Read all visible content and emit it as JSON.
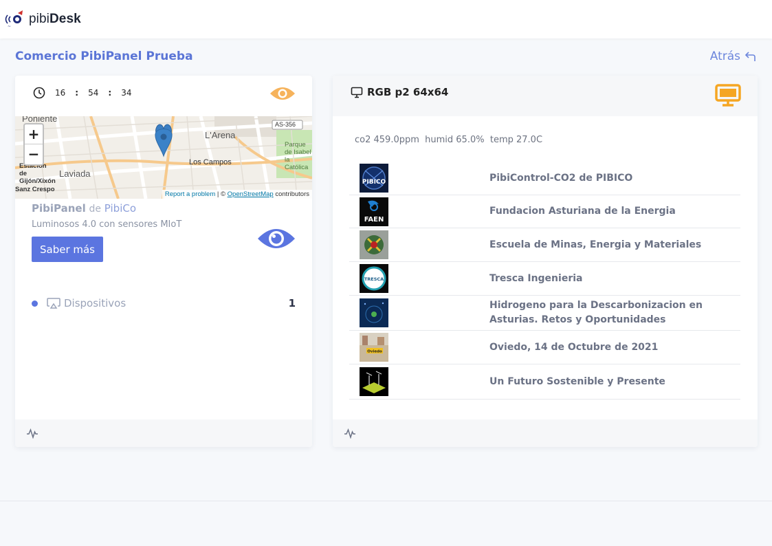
{
  "app": {
    "brand_light": "pibi",
    "brand_bold": "Desk"
  },
  "page": {
    "title": "Comercio PibiPanel Prueba",
    "back_label": "Atrás"
  },
  "left_card": {
    "clock": {
      "hours": "16",
      "minutes": "54",
      "seconds": "34",
      "separator": ":"
    },
    "map": {
      "labels": [
        "Poniente",
        "L'Arena",
        "AS-356",
        "Parque de Isabel la Católica",
        "Laviada",
        "Los Campos",
        "Estación de Gijón/Xixón",
        "Sanz Crespo"
      ],
      "zoom_in": "+",
      "zoom_out": "−",
      "attribution_report": "Report a problem",
      "attribution_sep": " | © ",
      "attribution_osm": "OpenStreetMap",
      "attribution_tail": " contributors"
    },
    "panel_name": "PibiPanel",
    "panel_de": "de",
    "panel_owner": "PibiCo",
    "panel_subtitle": "Luminosos 4.0 con sensores MIoT",
    "more_button": "Saber más",
    "devices_label": "Dispositivos",
    "devices_count": "1"
  },
  "right_card": {
    "title": "RGB p2 64x64",
    "sensors": "co2 459.0ppm  humid 65.0%  temp 27.0C",
    "slides": [
      {
        "name": "PibiControl-CO2 de PIBICO",
        "thumb": "PIBICO"
      },
      {
        "name": "Fundacion Asturiana de la Energia",
        "thumb": "FAEN"
      },
      {
        "name": "Escuela de Minas, Energia y Materiales",
        "thumb": ""
      },
      {
        "name": "Tresca Ingenieria",
        "thumb": "TRESCA"
      },
      {
        "name": "Hidrogeno para la Descarbonizacion en Asturias. Retos y Oportunidades",
        "thumb": ""
      },
      {
        "name": "Oviedo, 14 de Octubre de 2021",
        "thumb": "Oviedo"
      },
      {
        "name": "Un Futuro Sostenible y Presente",
        "thumb": ""
      }
    ]
  },
  "colors": {
    "accent": "#5b75e0",
    "eye_orange": "#f6b35c",
    "monitor_orange": "#f5a623"
  }
}
